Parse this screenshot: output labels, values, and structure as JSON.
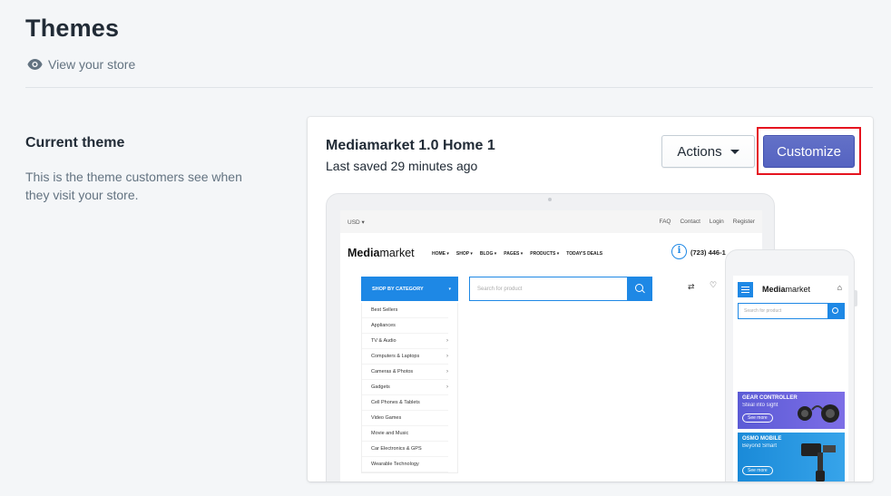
{
  "header": {
    "title": "Themes",
    "view_store": "View your store"
  },
  "current_theme": {
    "section_title": "Current theme",
    "section_desc": "This is the theme customers see when they visit your store.",
    "theme_name": "Mediamarket 1.0 Home 1",
    "last_saved": "Last saved 29 minutes ago",
    "actions_label": "Actions",
    "customize_label": "Customize"
  },
  "preview": {
    "currency": "USD ▾",
    "top_links": [
      "FAQ",
      "Contact",
      "Login",
      "Register"
    ],
    "logo_bold": "Media",
    "logo_rest": "market",
    "nav": [
      "HOME ▾",
      "SHOP ▾",
      "BLOG ▾",
      "PAGES ▾",
      "PRODUCTS ▾",
      "TODAY'S DEALS"
    ],
    "phone": "(723) 446-1",
    "shop_by_category": "SHOP BY CATEGORY",
    "search_placeholder": "Search for product",
    "categories": [
      {
        "label": "Best Sellers",
        "arrow": ""
      },
      {
        "label": "Appliances",
        "arrow": ""
      },
      {
        "label": "TV & Audio",
        "arrow": "›"
      },
      {
        "label": "Computers & Laptops",
        "arrow": "›"
      },
      {
        "label": "Cameras & Photos",
        "arrow": "›"
      },
      {
        "label": "Gadgets",
        "arrow": "›"
      },
      {
        "label": "Cell Phones & Tablets",
        "arrow": ""
      },
      {
        "label": "Video Games",
        "arrow": ""
      },
      {
        "label": "Movie and Music",
        "arrow": ""
      },
      {
        "label": "Car Electronics & GPS",
        "arrow": ""
      },
      {
        "label": "Wearable Technology",
        "arrow": ""
      }
    ],
    "mobile": {
      "search_placeholder": "Search for product",
      "banner1_title": "GEAR CONTROLLER",
      "banner1_sub": "Steal into sight",
      "banner2_title": "OSMO MOBILE",
      "banner2_sub": "Beyond Smart",
      "see_more": "See more"
    }
  }
}
